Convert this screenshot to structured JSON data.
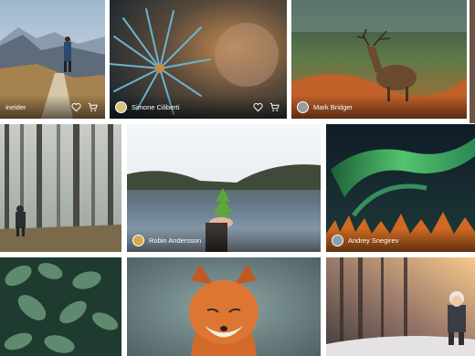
{
  "gallery": {
    "tiles": [
      {
        "photographer": "ineider",
        "show_actions": true
      },
      {
        "photographer": "Simone Ciliberti",
        "show_actions": true
      },
      {
        "photographer": "Mark Bridger",
        "show_actions": false
      },
      {
        "photographer": "",
        "show_actions": false
      },
      {
        "photographer": "Robin Andersson",
        "show_actions": false
      },
      {
        "photographer": "Andrey Snegirev",
        "show_actions": false
      },
      {
        "photographer": "",
        "show_actions": false
      },
      {
        "photographer": "",
        "show_actions": false
      },
      {
        "photographer": "",
        "show_actions": false
      }
    ],
    "icons": {
      "like": "heart-icon",
      "cart": "cart-icon"
    }
  }
}
